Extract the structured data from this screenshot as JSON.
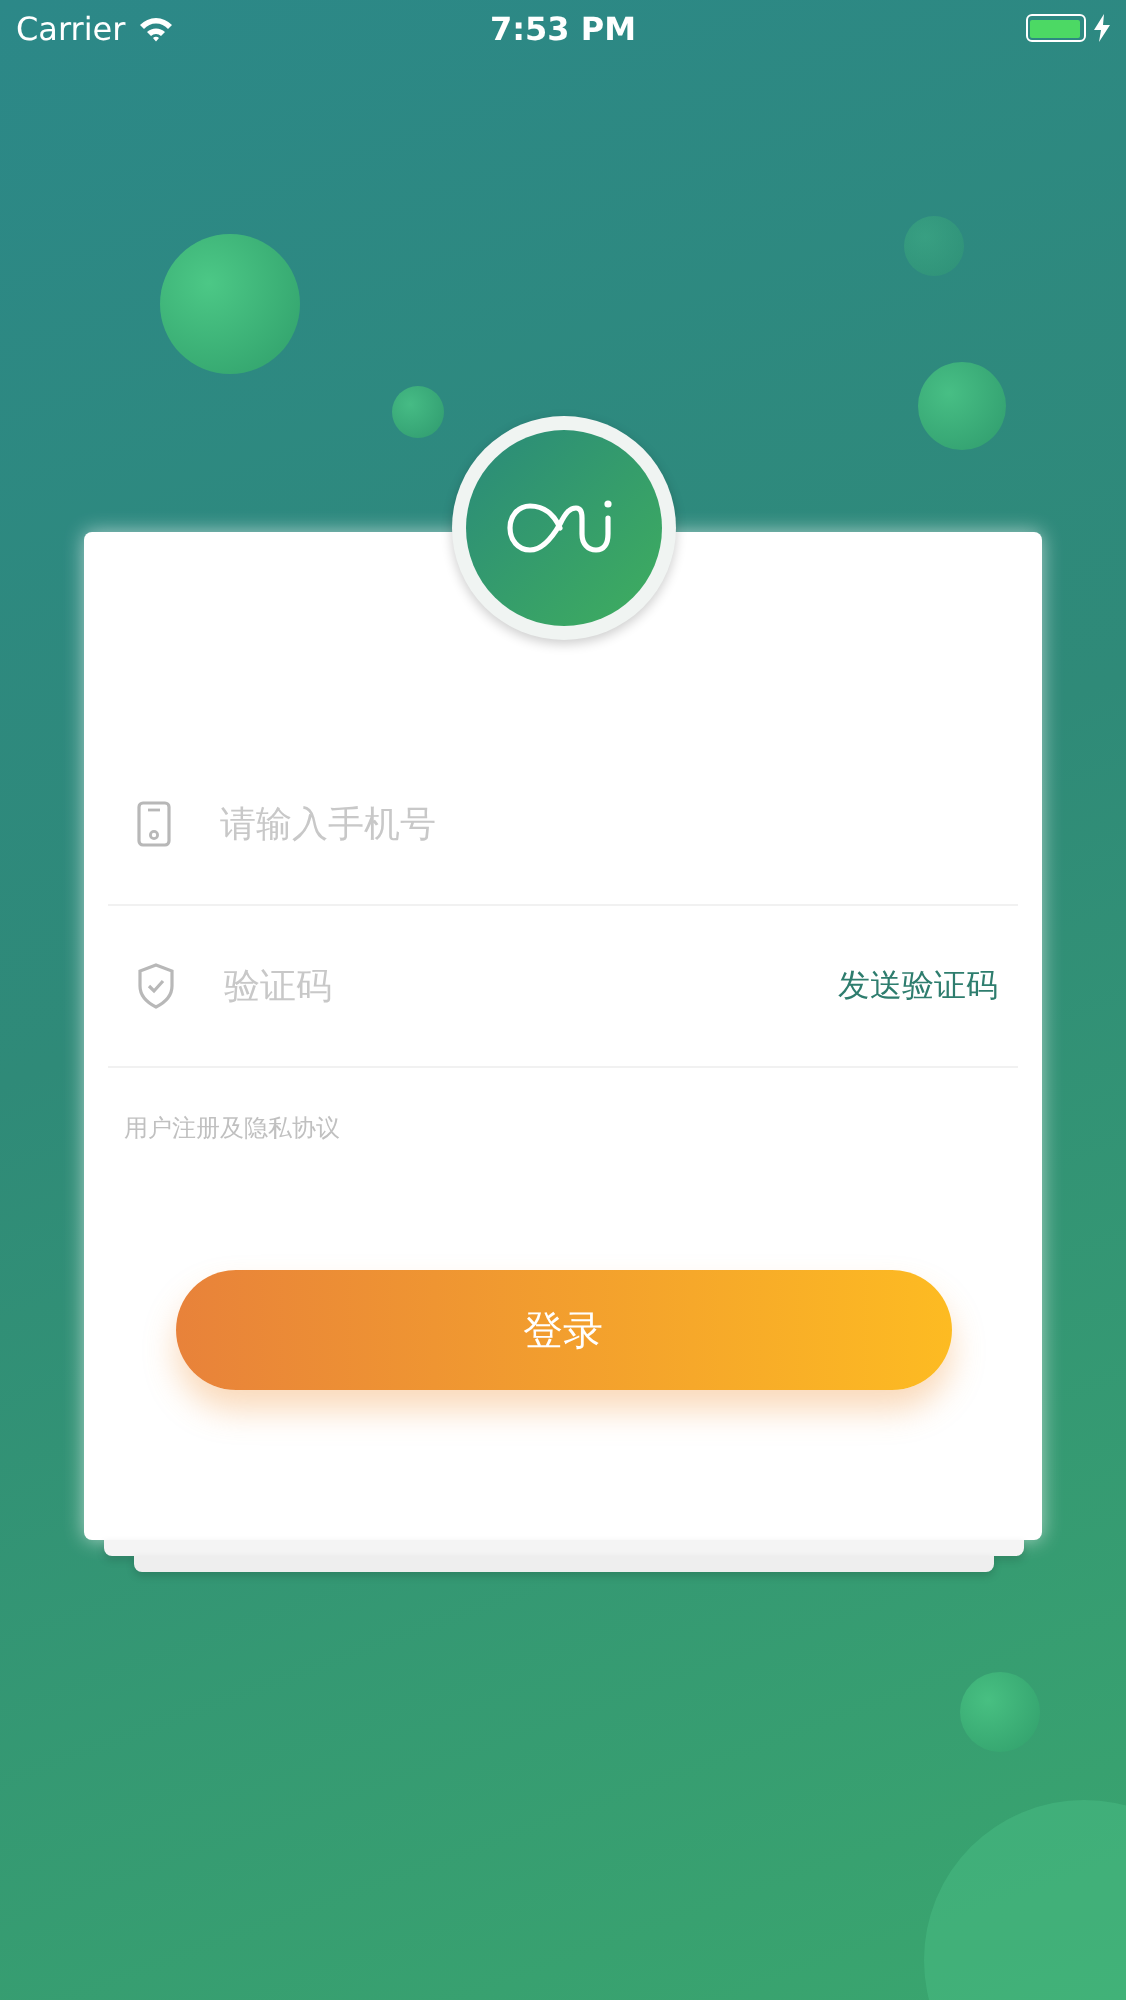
{
  "status_bar": {
    "carrier": "Carrier",
    "time": "7:53 PM",
    "charging": true
  },
  "form": {
    "fields": [
      {
        "kind": "phone",
        "placeholder": "请输入手机号"
      },
      {
        "kind": "code",
        "placeholder": "验证码",
        "action": "发送验证码"
      }
    ],
    "agreement": "用户注册及隐私协议",
    "submit": "登录"
  }
}
